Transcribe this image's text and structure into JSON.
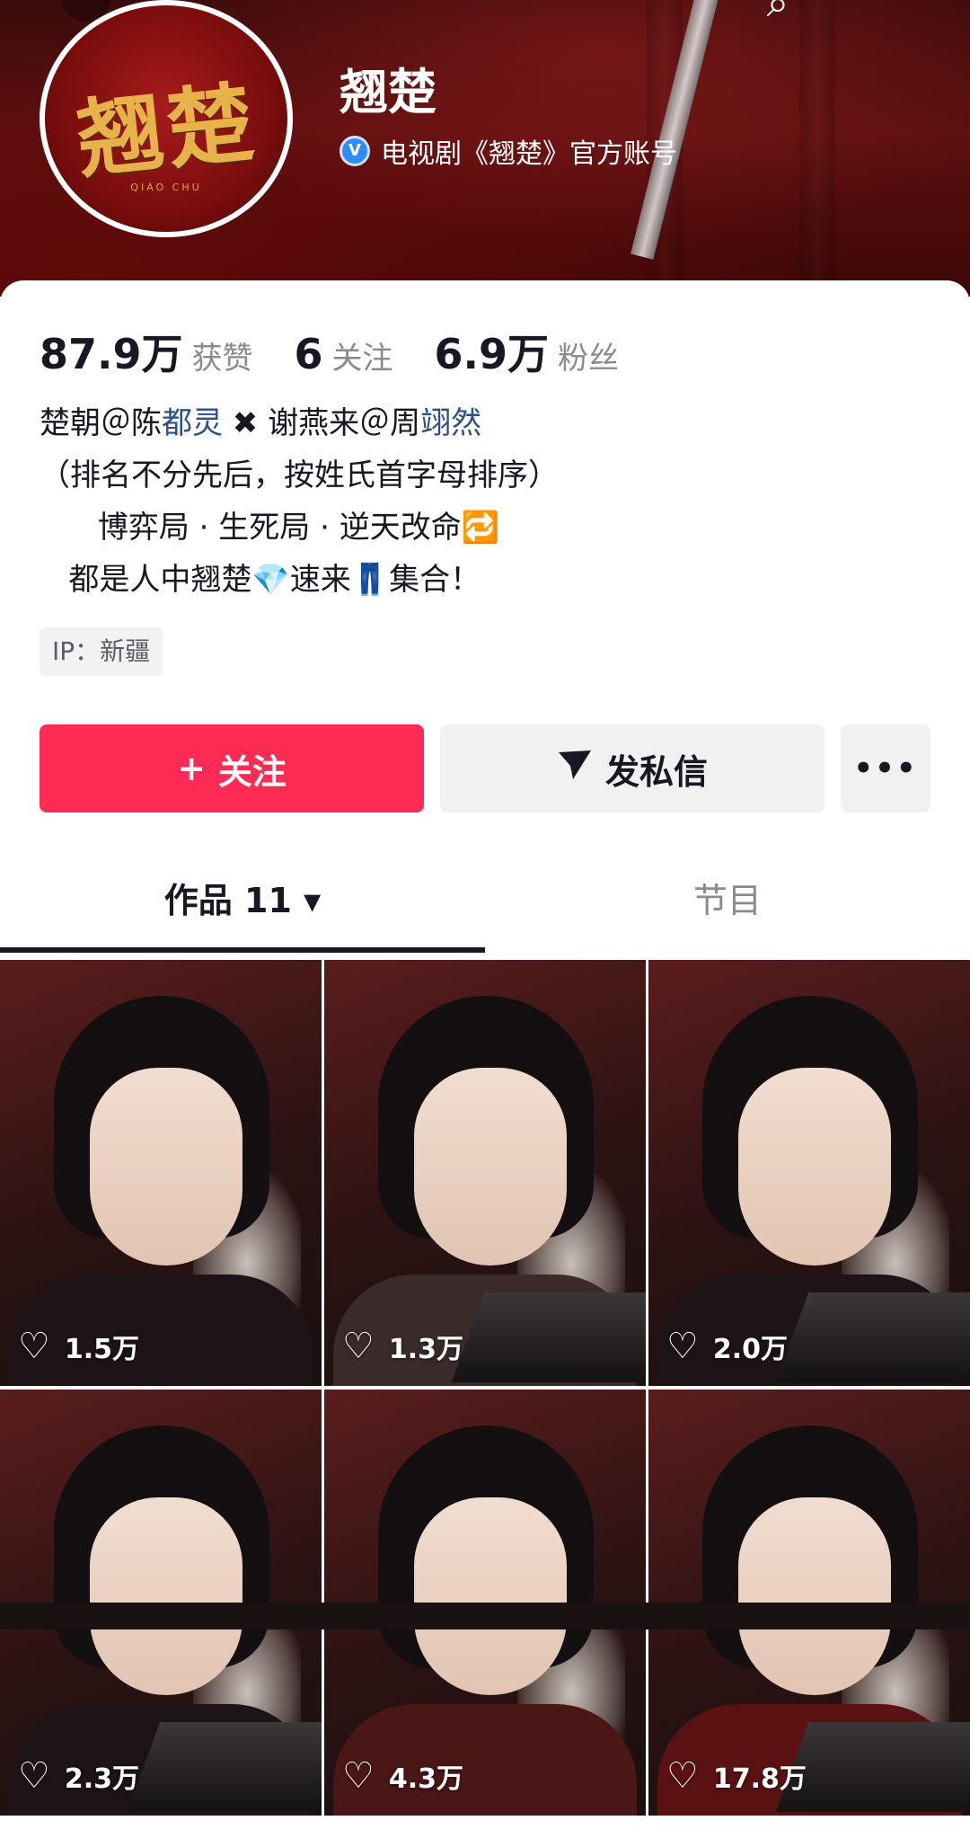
{
  "header": {
    "account_name": "翘楚",
    "verified_badge": "V",
    "verified_text": "电视剧《翘楚》官方账号",
    "avatar_logo_text": "翘楚",
    "avatar_logo_sub": "QIAO CHU",
    "search_icon": "search-icon",
    "back_icon": "back-icon"
  },
  "stats": [
    {
      "value": "87.9万",
      "label": "获赞"
    },
    {
      "value": "6",
      "label": "关注"
    },
    {
      "value": "6.9万",
      "label": "粉丝"
    }
  ],
  "bio": {
    "line1_a": "楚朝＠陈",
    "line1_b": "都灵",
    "line1_c": " ✖ 谢燕来＠周",
    "line1_d": "翊然",
    "line2": "（排名不分先后，按姓氏首字母排序）",
    "line3": "      博弈局 · 生死局 · 逆天改命🔁",
    "line4": "   都是人中翘楚💎速来👖集合！"
  },
  "ip_location": "IP：新疆",
  "actions": {
    "follow_icon": "+",
    "follow_label": "关注",
    "dm_icon": "send-icon",
    "dm_label": "发私信",
    "more_label": "•••"
  },
  "tabs": {
    "works_label": "作品 11",
    "works_dropdown_icon": "▾",
    "shows_label": "节目"
  },
  "videos": [
    {
      "likes": "1.5万"
    },
    {
      "likes": "1.3万"
    },
    {
      "likes": "2.0万"
    },
    {
      "likes": "2.3万"
    },
    {
      "likes": "4.3万"
    },
    {
      "likes": "17.8万"
    }
  ],
  "colors": {
    "follow_button": "#fe2c55",
    "link_blue": "#2b4f86",
    "banner_red": "#5a1010",
    "verify_blue": "#2f8cff"
  }
}
